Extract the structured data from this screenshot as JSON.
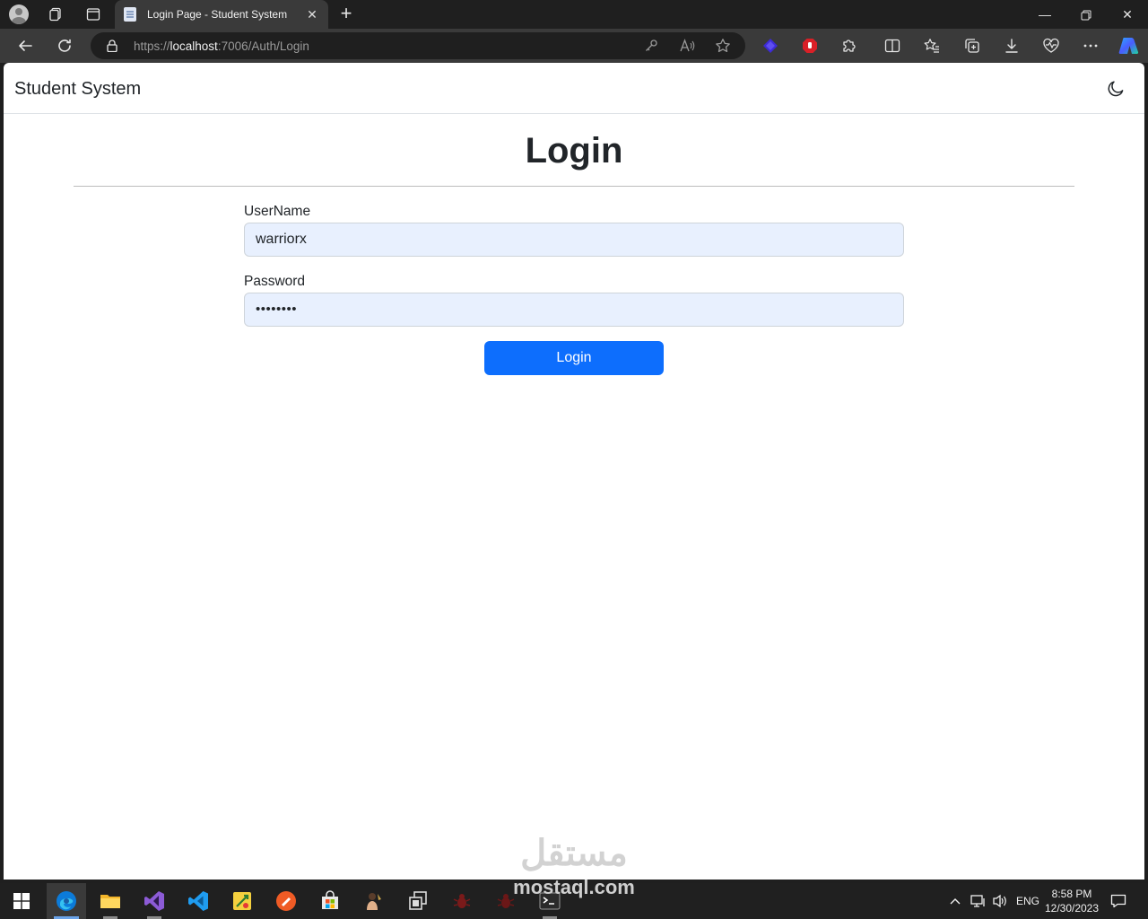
{
  "browser": {
    "tab_title": "Login Page - Student System",
    "url_scheme": "https://",
    "url_host": "localhost",
    "url_rest": ":7006/Auth/Login"
  },
  "site": {
    "brand": "Student System",
    "page_title": "Login",
    "username_label": "UserName",
    "username_value": "warriorx",
    "password_label": "Password",
    "password_masked": "••••••••",
    "login_button": "Login"
  },
  "watermark": {
    "arabic": "مستقل",
    "latin": "mostaql.com"
  },
  "taskbar": {
    "language": "ENG",
    "time": "8:58 PM",
    "date": "12/30/2023",
    "apps": [
      "start-icon",
      "edge-icon",
      "file-explorer-icon",
      "visual-studio-icon",
      "vscode-icon",
      "tool-icon",
      "postman-icon",
      "store-icon",
      "app-icon",
      "window-switcher-icon",
      "bug-icon",
      "bug-icon",
      "terminal-icon"
    ]
  },
  "colors": {
    "primary": "#0d6efd",
    "autofill": "#e8f0fe",
    "chrome_dark": "#1f1f1f",
    "toolbar": "#3a3a3a"
  }
}
